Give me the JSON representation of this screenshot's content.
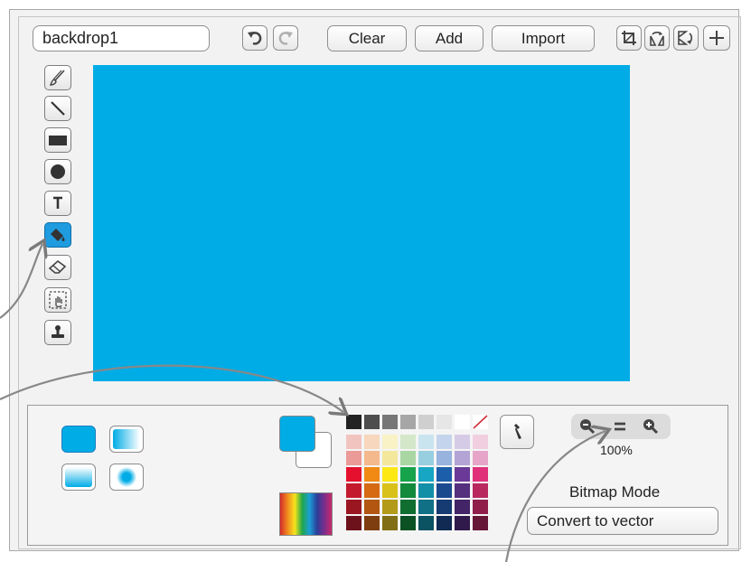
{
  "editor": {
    "costume_name": "backdrop1",
    "buttons": {
      "clear": "Clear",
      "add": "Add",
      "import": "Import"
    },
    "canvas_color": "#00ace6",
    "tools": [
      "brush-icon",
      "line-icon",
      "rectangle-icon",
      "ellipse-icon",
      "text-icon",
      "fill-icon",
      "eraser-icon",
      "select-icon",
      "stamp-icon"
    ],
    "selected_tool": "fill-icon"
  },
  "colors": {
    "primary": "#00ace6",
    "secondary": "#ffffff",
    "palette": [
      [
        "#222222",
        "#4d4d4d",
        "#777777",
        "#a6a6a6",
        "#cfcfcf",
        "#e6e6e6",
        "#ffffff",
        "none"
      ],
      [
        "#f2c4c0",
        "#f7d7bd",
        "#f9f2c6",
        "#d4e8c9",
        "#c9e4ef",
        "#c4d4ec",
        "#d6cbe6",
        "#f1cfe0"
      ],
      [
        "#eb9a97",
        "#f4b98c",
        "#f3e79b",
        "#a9d6a3",
        "#98cfe0",
        "#97b3de",
        "#b4a4d6",
        "#e6a5c8"
      ],
      [
        "#e4102d",
        "#f18a14",
        "#fde814",
        "#17a34a",
        "#17a7c4",
        "#1c5ea9",
        "#6b3a98",
        "#e0307a"
      ],
      [
        "#c41a2d",
        "#d56a12",
        "#d9c11a",
        "#138a3c",
        "#138fa8",
        "#1b4a8f",
        "#55307f",
        "#b8285f"
      ],
      [
        "#9a1722",
        "#b25612",
        "#b39a18",
        "#0f6e30",
        "#0f7086",
        "#163a72",
        "#432467",
        "#8f1f4a"
      ],
      [
        "#6d111b",
        "#7f3e0f",
        "#806f14",
        "#0b5124",
        "#0b5262",
        "#102a54",
        "#30194b",
        "#661637"
      ]
    ]
  },
  "zoom": {
    "level_label": "100%"
  },
  "mode": {
    "label": "Bitmap Mode",
    "convert_button": "Convert to vector"
  }
}
